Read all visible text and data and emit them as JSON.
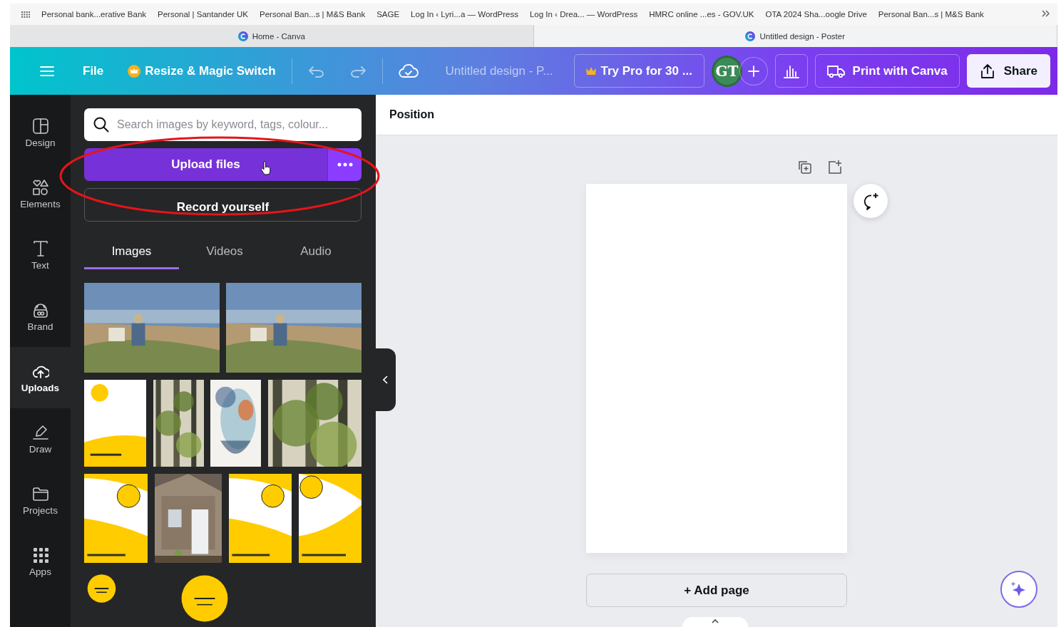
{
  "bookmarks": [
    "Personal bank...erative Bank",
    "Personal | Santander UK",
    "Personal Ban...s | M&S Bank",
    "SAGE",
    "Log In ‹ Lyri...a — WordPress",
    "Log In ‹ Drea... — WordPress",
    "HMRC online ...es - GOV.UK",
    "OTA 2024 Sha...oogle Drive",
    "Personal Ban...s | M&S Bank"
  ],
  "browser_tabs": [
    {
      "title": "Home - Canva",
      "selected": false
    },
    {
      "title": "Untitled design - Poster",
      "selected": true
    }
  ],
  "toolbar": {
    "file": "File",
    "resize": "Resize & Magic Switch",
    "design_title": "Untitled design - P...",
    "try_pro": "Try Pro for 30 ...",
    "avatar": "GT",
    "print": "Print with Canva",
    "share": "Share"
  },
  "rail": [
    {
      "label": "Design",
      "selected": false
    },
    {
      "label": "Elements",
      "selected": false
    },
    {
      "label": "Text",
      "selected": false
    },
    {
      "label": "Brand",
      "selected": false
    },
    {
      "label": "Uploads",
      "selected": true
    },
    {
      "label": "Draw",
      "selected": false
    },
    {
      "label": "Projects",
      "selected": false
    },
    {
      "label": "Apps",
      "selected": false
    }
  ],
  "panel": {
    "search": {
      "placeholder": "Search images by keyword, tags, colour..."
    },
    "upload_button": "Upload files",
    "record_button": "Record yourself",
    "media_tabs": [
      {
        "label": "Images",
        "selected": true
      },
      {
        "label": "Videos",
        "selected": false
      },
      {
        "label": "Audio",
        "selected": false
      }
    ]
  },
  "editor": {
    "context_label": "Position",
    "add_page": "+ Add page"
  }
}
